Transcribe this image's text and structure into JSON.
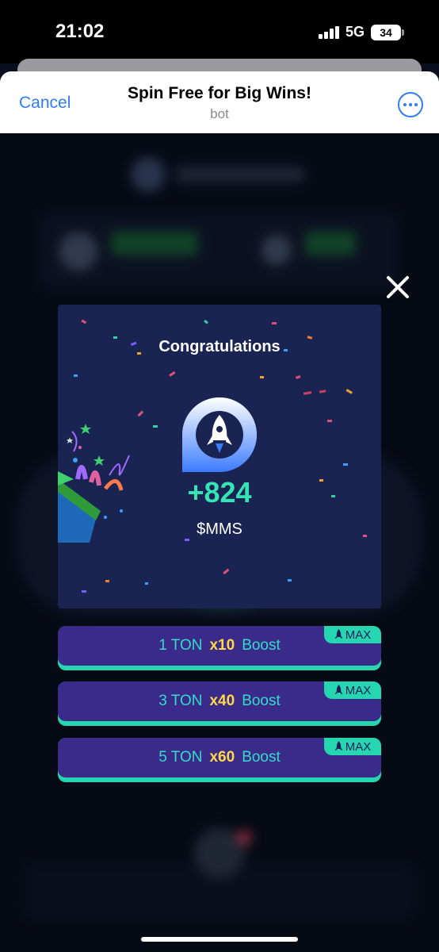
{
  "status": {
    "time": "21:02",
    "network": "5G",
    "battery": "34"
  },
  "header": {
    "cancel_label": "Cancel",
    "title": "Spin Free for Big Wins!",
    "subtitle": "bot"
  },
  "modal": {
    "title": "Congratulations",
    "amount": "+824",
    "currency": "$MMS"
  },
  "boosts": [
    {
      "ton": "1 TON",
      "multiplier": "x10",
      "label": "Boost",
      "badge": "MAX"
    },
    {
      "ton": "3 TON",
      "multiplier": "x40",
      "label": "Boost",
      "badge": "MAX"
    },
    {
      "ton": "5 TON",
      "multiplier": "x60",
      "label": "Boost",
      "badge": "MAX"
    }
  ],
  "colors": {
    "accent_blue": "#2f7cf6",
    "modal_bg": "#1a2453",
    "amount_green": "#36e3b4",
    "boost_face": "#3a2b8a",
    "boost_teal": "#25d6b1",
    "multiplier_yellow": "#ffd84a"
  },
  "icons": [
    "signal-icon",
    "battery-icon",
    "more-icon",
    "close-icon",
    "rocket-logo-icon",
    "party-popper-icon",
    "rocket-small-icon"
  ]
}
